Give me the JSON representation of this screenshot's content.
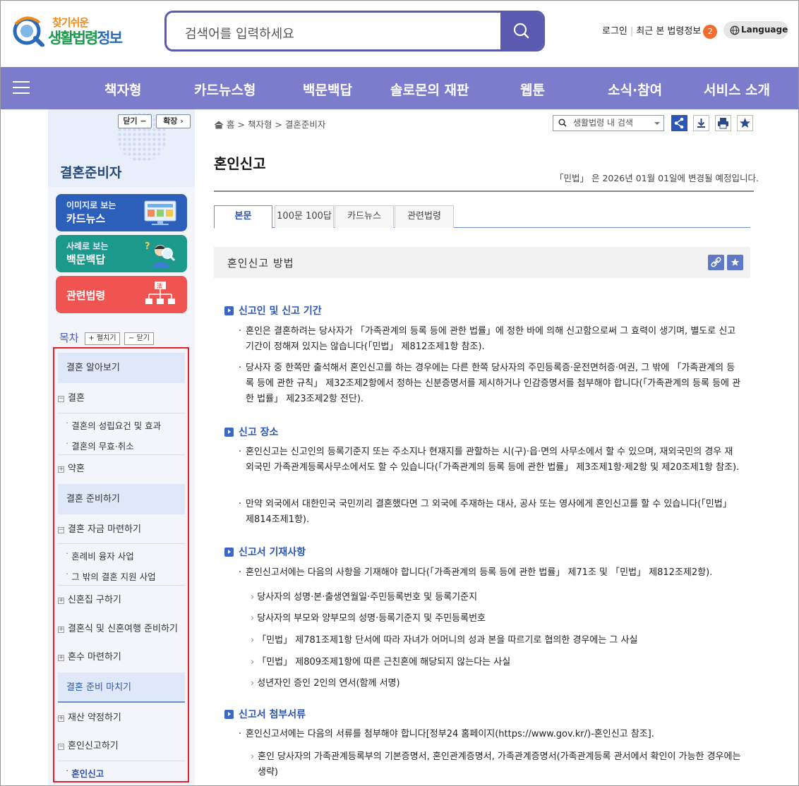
{
  "header": {
    "logo_top": "찾기쉬운",
    "logo_main_a": "생활법령",
    "logo_main_b": "정보",
    "search_placeholder": "검색어를 입력하세요",
    "login": "로그인",
    "recent": "최근 본 법령정보",
    "recent_count": "2",
    "language": "Language"
  },
  "nav": {
    "items": [
      "책자형",
      "카드뉴스형",
      "백문백답",
      "솔로몬의 재판",
      "웹툰",
      "소식·참여",
      "서비스 소개"
    ]
  },
  "sidebar": {
    "collapse": "닫기",
    "expand": "확장",
    "title": "결혼준비자",
    "cards": [
      {
        "small": "이미지로 보는",
        "big": "카드뉴스"
      },
      {
        "small": "사례로 보는",
        "big": "백문백답"
      },
      {
        "big": "관련법령"
      }
    ],
    "toc_label": "목차",
    "toc_expand": "+ 펼치기",
    "toc_close": "− 닫기",
    "toc": {
      "sec1": "결혼 알아보기",
      "g1": "결혼",
      "s1": "결혼의 성립요건 및 효과",
      "s2": "결혼의 무효·취소",
      "g2": "약혼",
      "sec2": "결혼 준비하기",
      "g3": "결혼 자금 마련하기",
      "s3": "혼례비 융자 사업",
      "s4": "그 밖의 결혼 지원 사업",
      "g4": "신혼집 구하기",
      "g5": "결혼식 및 신혼여행 준비하기",
      "g6": "혼수 마련하기",
      "sec3": "결혼 준비 마치기",
      "g7": "재산 약정하기",
      "g8": "혼인신고하기",
      "s5": "혼인신고"
    }
  },
  "main": {
    "breadcrumb": [
      "홈",
      "책자형",
      "결혼준비자"
    ],
    "inner_search": "생활법령 내 검색",
    "title": "혼인신고",
    "notice": "「민법」 은 2026년 01월 01일에 변경될 예정입니다.",
    "tabs": [
      "본문",
      "100문 100답",
      "카드뉴스",
      "관련법령"
    ],
    "section_title": "혼인신고 방법",
    "h1": "신고인 및 신고 기간",
    "p1": "혼인은 결혼하려는 당사자가 「가족관계의 등록 등에 관한 법률」에 정한 바에 의해 신고함으로써 그 효력이 생기며, 별도로 신고 기간이 정해져 있지는 않습니다(「민법」 제812조제1항 참조).",
    "p2": "당사자 중 한쪽만 출석해서 혼인신고를 하는 경우에는 다른 한쪽 당사자의 주민등록증·운전면허증·여권, 그 밖에 「가족관계의 등록 등에 관한 규칙」 제32조제2항에서 정하는 신분증명서를 제시하거나 인감증명서를 첨부해야 합니다(「가족관계의 등록 등에 관한 법률」 제23조제2항 전단).",
    "h2": "신고 장소",
    "p3": "혼인신고는 신고인의 등록기준지 또는 주소지나 현재지를 관할하는 시(구)·읍·면의 사무소에서 할 수 있으며, 재외국민의 경우 재외국민 가족관계등록사무소에서도 할 수 있습니다(「가족관계의 등록 등에 관한 법률」 제3조제1항·제2항 및 제20조제1항 참조).",
    "p4": "만약 외국에서 대한민국 국민끼리 결혼했다면 그 외국에 주재하는 대사, 공사 또는 영사에게 혼인신고를 할 수 있습니다(「민법」 제814조제1항).",
    "h3": "신고서 기재사항",
    "p5": "혼인신고서에는 다음의 사항을 기재해야 합니다(「가족관계의 등록 등에 관한 법률」 제71조 및 「민법」 제812조제2항).",
    "l1": "당사자의 성명·본·출생연월일·주민등록번호 및 등록기준지",
    "l2": "당사자의 부모와 양부모의 성명·등록기준지 및 주민등록번호",
    "l3": "「민법」 제781조제1항 단서에 따라 자녀가 어머니의 성과 본을 따르기로 협의한 경우에는 그 사실",
    "l4": "「민법」 제809조제1항에 따른 근친혼에 해당되지 않는다는 사실",
    "l5": "성년자인 증인 2인의 연서(함께 서명)",
    "h4": "신고서 첨부서류",
    "p6": "혼인신고서에는 다음의 서류를 첨부해야 합니다[정부24 홈페이지(https://www.gov.kr/)-혼인신고 참조].",
    "l6": "혼인 당사자의 가족관계등록부의 기본증명서, 혼인관계증명서, 가족관계증명서(가족관계등록 관서에서 확인이 가능한 경우에는 생략)"
  },
  "colors": {
    "nav_bg": "#7b7ccb",
    "search_border": "#5a5ab0",
    "accent_blue": "#2a56b6",
    "highlight_box": "#e5202b",
    "card_news": "#2c5fba",
    "card_qa": "#1b9a8c",
    "card_law": "#ef5451"
  }
}
